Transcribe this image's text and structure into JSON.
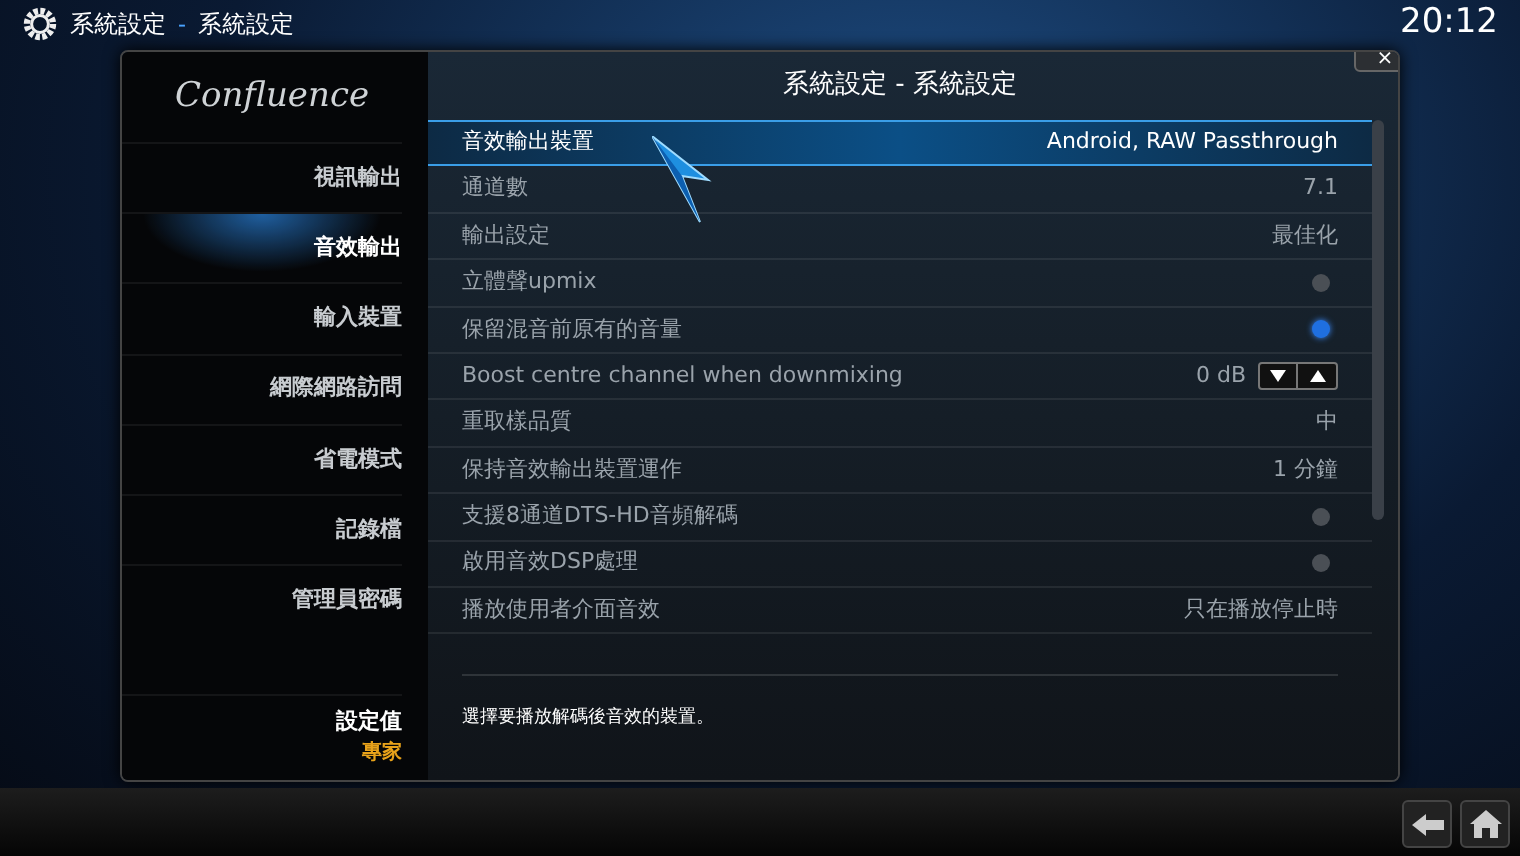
{
  "header": {
    "breadcrumb": [
      "系統設定",
      "系統設定"
    ],
    "separator": "-",
    "clock": "20:12"
  },
  "sidebar": {
    "logo": "Confluence",
    "items": [
      {
        "label": "視訊輸出",
        "selected": false
      },
      {
        "label": "音效輸出",
        "selected": true
      },
      {
        "label": "輸入裝置",
        "selected": false
      },
      {
        "label": "網際網路訪問",
        "selected": false
      },
      {
        "label": "省電模式",
        "selected": false
      },
      {
        "label": "記錄檔",
        "selected": false
      },
      {
        "label": "管理員密碼",
        "selected": false
      }
    ],
    "level_label": "設定值",
    "level_value": "專家"
  },
  "panel": {
    "title": "系統設定 - 系統設定",
    "close": "×"
  },
  "settings": [
    {
      "kind": "value",
      "label": "音效輸出裝置",
      "value": "Android, RAW Passthrough",
      "selected": true
    },
    {
      "kind": "value",
      "label": "通道數",
      "value": "7.1",
      "selected": false
    },
    {
      "kind": "value",
      "label": "輸出設定",
      "value": "最佳化",
      "selected": false
    },
    {
      "kind": "toggle",
      "label": "立體聲upmix",
      "on": false,
      "selected": false
    },
    {
      "kind": "toggle",
      "label": "保留混音前原有的音量",
      "on": true,
      "selected": false
    },
    {
      "kind": "spinner",
      "label": "Boost centre channel when downmixing",
      "value": "0 dB",
      "selected": false
    },
    {
      "kind": "value",
      "label": "重取樣品質",
      "value": "中",
      "selected": false
    },
    {
      "kind": "value",
      "label": "保持音效輸出裝置運作",
      "value": "1 分鐘",
      "selected": false
    },
    {
      "kind": "toggle",
      "label": "支援8通道DTS-HD音頻解碼",
      "on": false,
      "selected": false
    },
    {
      "kind": "toggle",
      "label": "啟用音效DSP處理",
      "on": false,
      "selected": false
    },
    {
      "kind": "value",
      "label": "播放使用者介面音效",
      "value": "只在播放停止時",
      "selected": false
    }
  ],
  "description": "選擇要播放解碼後音效的裝置。"
}
